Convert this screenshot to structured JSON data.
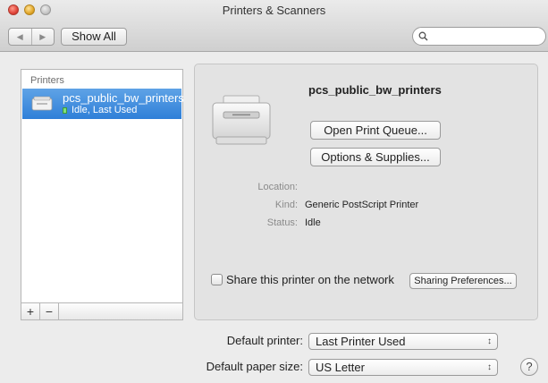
{
  "window": {
    "title": "Printers & Scanners"
  },
  "toolbar": {
    "back_glyph": "◀",
    "forward_glyph": "▶",
    "show_all_label": "Show All",
    "search_placeholder": "",
    "search_value": ""
  },
  "sidebar": {
    "header": "Printers",
    "printers": [
      {
        "name": "pcs_public_bw_printers",
        "status": "Idle, Last Used",
        "selected": true,
        "icon": "printer-icon"
      }
    ],
    "add_label": "+",
    "remove_label": "−"
  },
  "detail": {
    "printer_name": "pcs_public_bw_printers",
    "open_queue_label": "Open Print Queue...",
    "options_supplies_label": "Options & Supplies...",
    "location_label": "Location:",
    "location_value": "",
    "kind_label": "Kind:",
    "kind_value": "Generic PostScript Printer",
    "status_label": "Status:",
    "status_value": "Idle",
    "share_checkbox_label": "Share this printer on the network",
    "share_checked": false,
    "sharing_prefs_label": "Sharing Preferences..."
  },
  "defaults": {
    "default_printer_label": "Default printer:",
    "default_printer_value": "Last Printer Used",
    "default_paper_label": "Default paper size:",
    "default_paper_value": "US Letter",
    "help_label": "?"
  },
  "colors": {
    "selection": "#2f7fd8",
    "status_ready": "#7fe07a"
  }
}
